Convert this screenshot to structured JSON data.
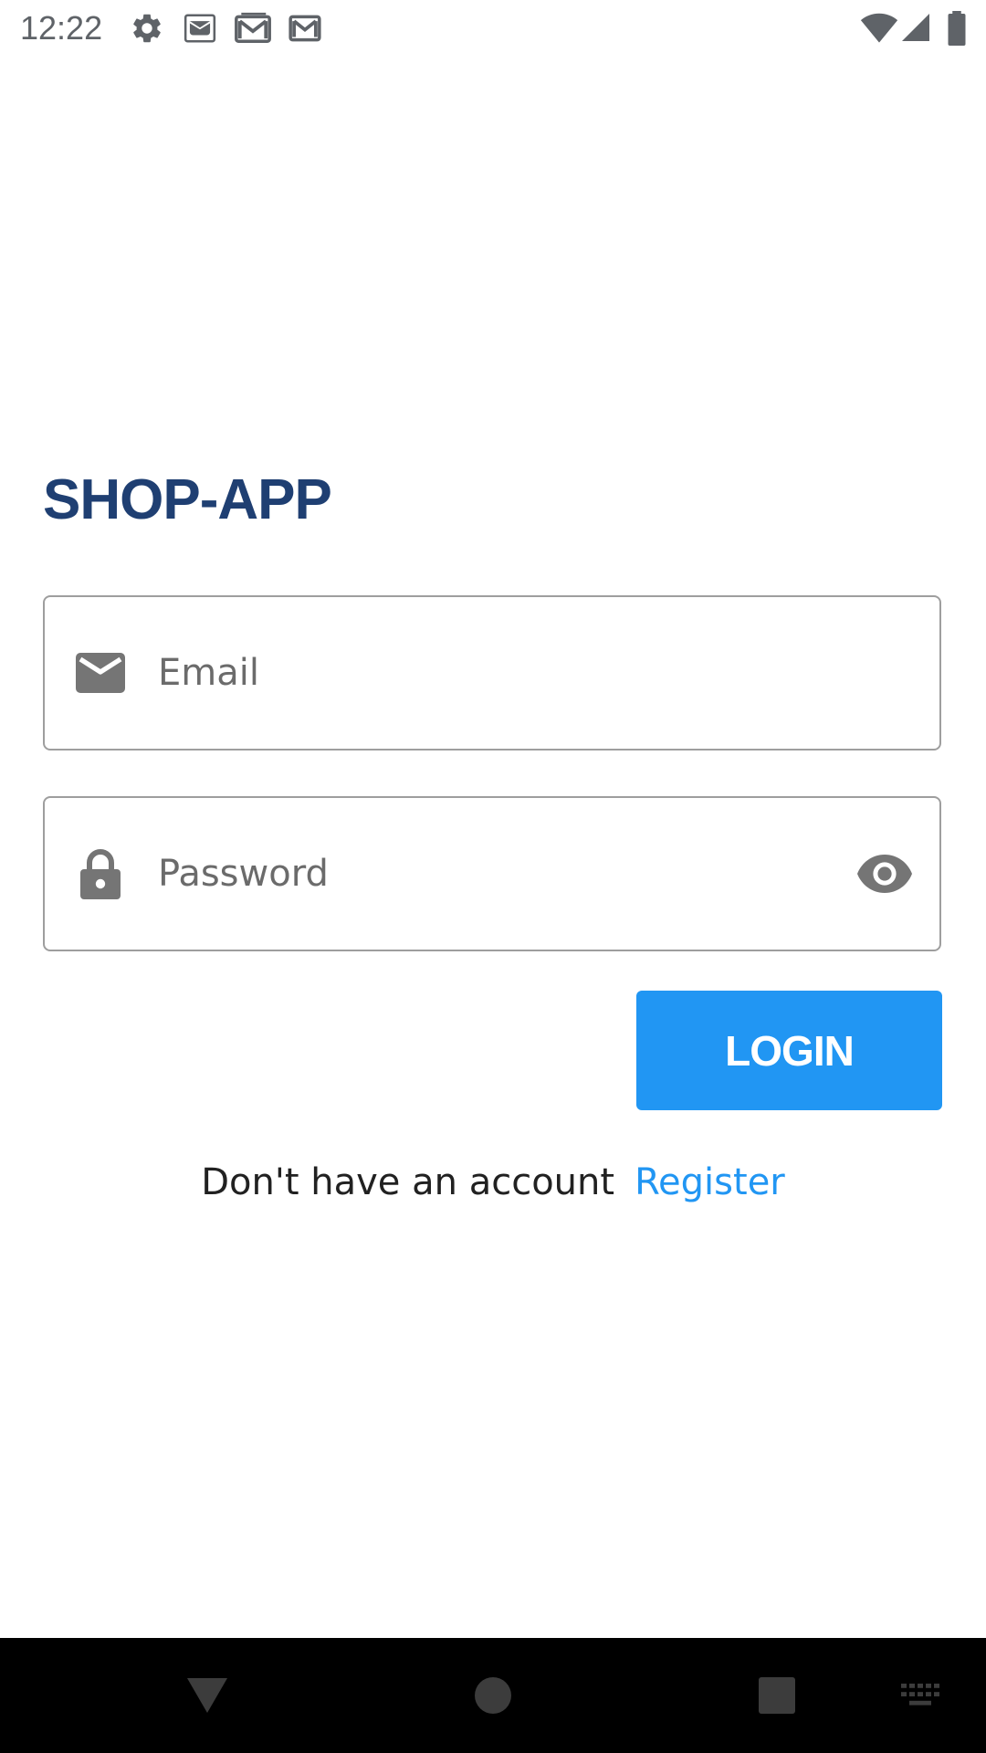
{
  "status_bar": {
    "time": "12:22",
    "left_icons": [
      "settings-icon",
      "mail-notification-icon",
      "gmail-notification-icon",
      "gmail-notification-icon"
    ],
    "right_icons": [
      "wifi-icon",
      "cellular-signal-icon",
      "battery-icon"
    ],
    "icon_color": "#5f6368"
  },
  "app": {
    "title": "SHOP-APP",
    "title_color": "#1f3f72"
  },
  "login_form": {
    "email": {
      "placeholder": "Email",
      "value": "",
      "icon": "email-icon"
    },
    "password": {
      "placeholder": "Password",
      "value": "",
      "icon": "lock-icon",
      "toggle_icon": "eye-icon"
    },
    "login_label": "LOGIN",
    "accent_color": "#2196f3"
  },
  "register": {
    "prompt": "Don't have an account",
    "link_label": "Register"
  },
  "nav_bar": {
    "buttons": [
      "back-icon",
      "home-icon",
      "recents-icon",
      "keyboard-icon"
    ]
  }
}
